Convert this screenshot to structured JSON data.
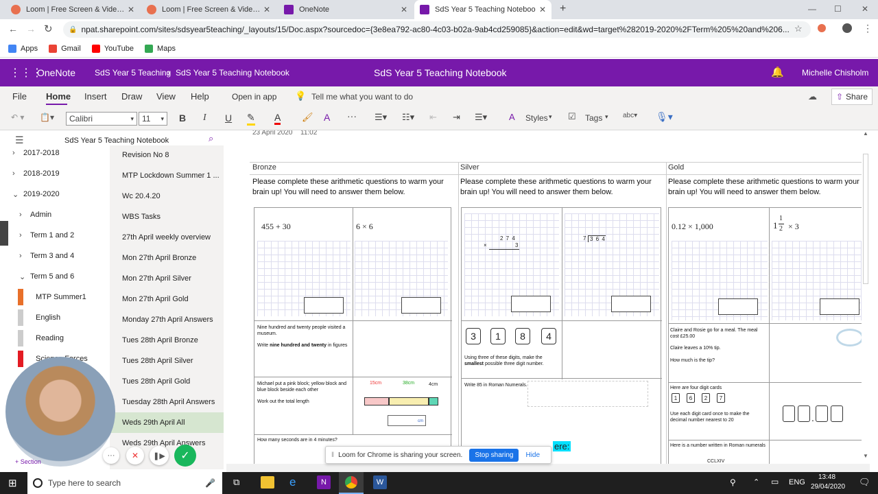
{
  "browser": {
    "tabs": [
      {
        "title": "Loom | Free Screen & Video Rec",
        "active": false,
        "color": "#e8704f"
      },
      {
        "title": "Loom | Free Screen & Video Rec",
        "active": false,
        "color": "#e8704f"
      },
      {
        "title": "OneNote",
        "active": false,
        "color": "#7719aa"
      },
      {
        "title": "SdS Year 5 Teaching Noteboo",
        "active": true,
        "color": "#7719aa"
      }
    ],
    "url": "npat.sharepoint.com/sites/sdsyear5teaching/_layouts/15/Doc.aspx?sourcedoc={3e8ea792-ac80-4c03-b02a-9ab4cd259085}&action=edit&wd=target%282019-2020%2FTerm%205%20and%206...",
    "bookmarks": [
      {
        "label": "Apps",
        "color": "#4285f4"
      },
      {
        "label": "Gmail",
        "color": "#ea4335"
      },
      {
        "label": "YouTube",
        "color": "#ff0000"
      },
      {
        "label": "Maps",
        "color": "#34a853"
      }
    ]
  },
  "onenote": {
    "app": "OneNote",
    "breadcrumb1": "SdS Year 5 Teaching",
    "breadcrumb2": "SdS Year 5 Teaching Notebook",
    "title": "SdS Year 5 Teaching Notebook",
    "user": "Michelle Chisholm",
    "ribbon_tabs": [
      "File",
      "Home",
      "Insert",
      "Draw",
      "View",
      "Help"
    ],
    "open_in_app": "Open in app",
    "tell_me": "Tell me what you want to do",
    "share": "Share",
    "font": "Calibri",
    "size": "11",
    "styles": "Styles",
    "tags": "Tags"
  },
  "nav": {
    "notebook": "SdS Year 5 Teaching Notebook",
    "sections": [
      {
        "label": "2017-2018",
        "indent": 0,
        "color": ""
      },
      {
        "label": "2018-2019",
        "indent": 0,
        "color": ""
      },
      {
        "label": "2019-2020",
        "indent": 0,
        "color": ""
      },
      {
        "label": "Admin",
        "indent": 1,
        "color": ""
      },
      {
        "label": "Term 1 and 2",
        "indent": 1,
        "color": ""
      },
      {
        "label": "Term 3 and 4",
        "indent": 1,
        "color": ""
      },
      {
        "label": "Term 5 and 6",
        "indent": 1,
        "color": ""
      },
      {
        "label": "MTP Summer1",
        "indent": 2,
        "color": "#e8702a"
      },
      {
        "label": "English",
        "indent": 2,
        "color": "#cccccc"
      },
      {
        "label": "Reading",
        "indent": 2,
        "color": "#cccccc"
      },
      {
        "label": "Science Forces",
        "indent": 2,
        "color": "#e31b23"
      }
    ],
    "pages": [
      "Revision No 8",
      "MTP Lockdown Summer 1 ...",
      "Wc 20.4.20",
      "WBS Tasks",
      "27th April weekly overview",
      "Mon 27th April Bronze",
      "Mon 27th April Silver",
      "Mon 27th April Gold",
      "Monday 27th April Answers",
      "Tues 28th April Bronze",
      "Tues 28th April Silver",
      "Tues 28th April Gold",
      "Tuesday 28th April Answers",
      "Weds 29th April All",
      "Weds 29th April Answers"
    ],
    "selected_page": "Weds 29th April All",
    "add_section": "+ Section"
  },
  "page": {
    "date": "23 April 2020",
    "time": "11:02",
    "columns": [
      "Bronze",
      "Silver",
      "Gold"
    ],
    "intro": "Please complete these arithmetic questions to warm your brain up! You will need to answer them below.",
    "intro_gold": "Please complete these arithmetic questions to warm your b",
    "bronze": {
      "q1": "455 + 30",
      "q2": "6 × 6",
      "q3a": "Nine hundred and twenty people visited a museum.",
      "q3b_pre": "Write ",
      "q3b_bold": "nine hundred and twenty",
      "q3b_post": " in figures",
      "q4a": "Michael put a pink block; yellow block and blue block beside each other",
      "q4b": "Work out the total length",
      "len1": "15cm",
      "len2": "38cm",
      "len3": "4cm",
      "unit": "cm",
      "q5": "How many seconds are in 4 minutes?"
    },
    "silver": {
      "mul_top": "2 7 4",
      "mul_bottom": "3",
      "mul_sign": "×",
      "div_divisor": "7",
      "div_dividend": "3 6 4",
      "digits": [
        "3",
        "1",
        "8",
        "4"
      ],
      "q3_pre": "Using three of these digits, make the ",
      "q3_bold": "smallest",
      "q3_post": " possible three digit number.",
      "q4": "Write 85 in Roman Numerals.",
      "partial": "ere:"
    },
    "gold": {
      "q1": "0.12 × 1,000",
      "mixed_whole": "1",
      "mixed_num": "1",
      "mixed_den": "2",
      "mixed_op": "× 3",
      "q3a": "Claire and Rosie go for a meal. The meal cost £25.00",
      "q3b": "Claire leaves a 10% tip.",
      "q3c": "How much is the tip?",
      "q4a": "Here are four digit cards",
      "digits": [
        "1",
        "6",
        "2",
        "7"
      ],
      "q4b": "Use each digit card once to make the decimal number nearest to 20",
      "q5": "Here is a number written in Roman numerals",
      "q5_partial": "CCLXIV"
    }
  },
  "loom": {
    "message": "Loom for Chrome is sharing your screen.",
    "stop": "Stop sharing",
    "hide": "Hide"
  },
  "taskbar": {
    "search": "Type here to search",
    "lang": "ENG",
    "time": "13:48",
    "date": "29/04/2020"
  }
}
